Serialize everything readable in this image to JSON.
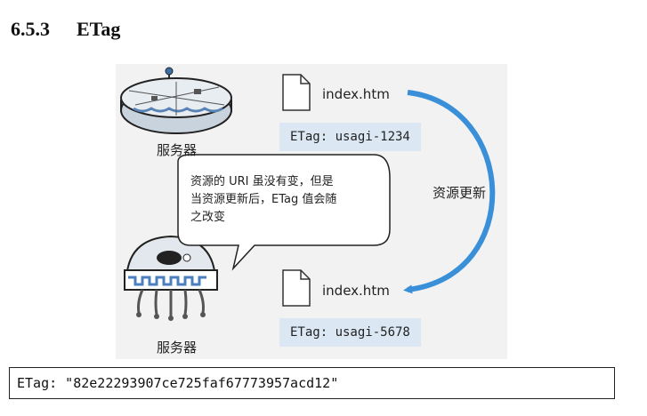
{
  "section": {
    "number": "6.5.3",
    "title": "ETag"
  },
  "figure": {
    "top_server": {
      "caption": "服务器",
      "icon": "server-icon"
    },
    "bottom_server": {
      "caption": "服务器",
      "icon": "jellyfish-server-icon"
    },
    "top_file": {
      "name": "index.htm",
      "etag": "ETag: usagi-1234",
      "icon": "file-icon"
    },
    "bottom_file": {
      "name": "index.htm",
      "etag": "ETag: usagi-5678",
      "icon": "file-icon"
    },
    "bubble": {
      "line1": "资源的 URI 虽没有变，但是",
      "line2": "当资源更新后，ETag 值会随",
      "line3": "之改变"
    },
    "arrow_label": "资源更新",
    "colors": {
      "arrow": "#3a8fd9",
      "etag_bg": "#dbe8f4",
      "figure_bg": "#f2f2f2"
    }
  },
  "code": "ETag: \"82e22293907ce725faf67773957acd12\""
}
